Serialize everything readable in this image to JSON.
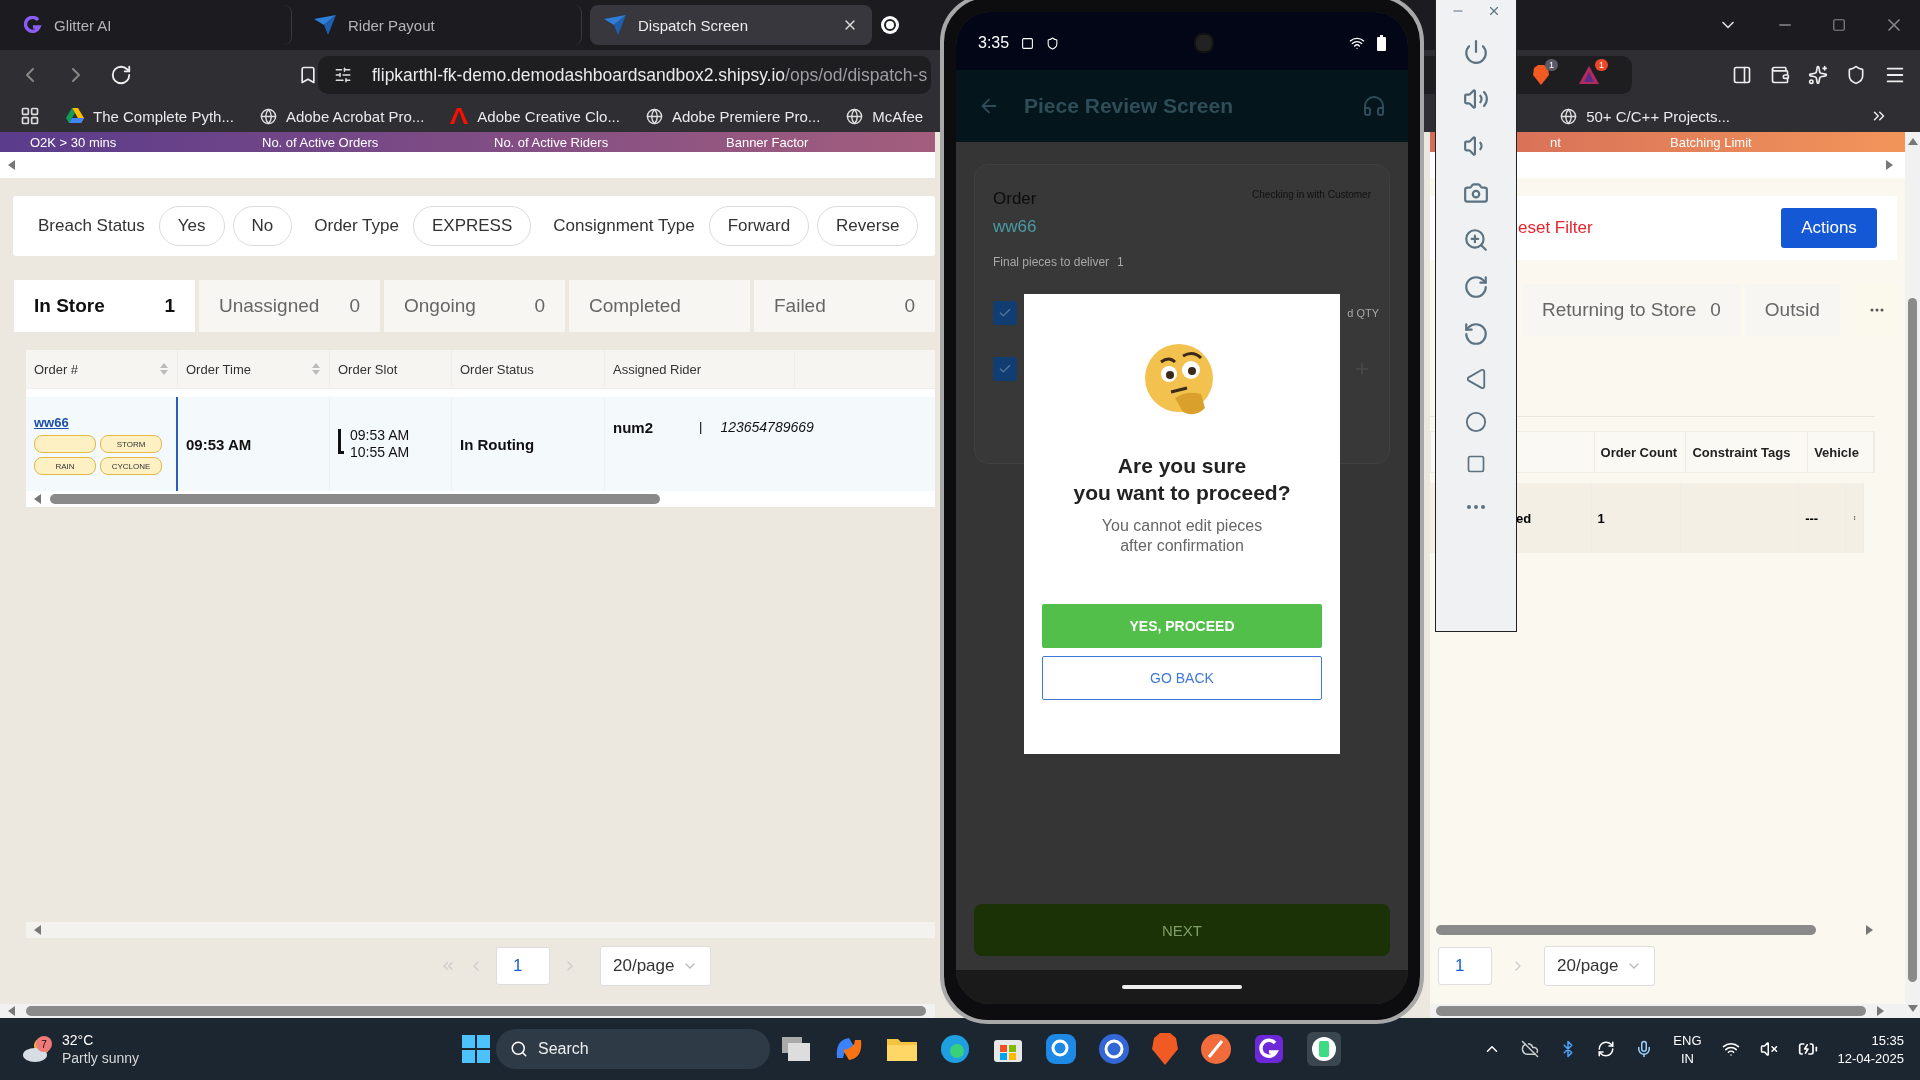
{
  "browser": {
    "tabs": [
      {
        "title": "Glitter AI",
        "selected": false,
        "kind": "glitter"
      },
      {
        "title": "Rider Payout",
        "selected": false,
        "kind": "shipsy"
      },
      {
        "title": "Dispatch Screen",
        "selected": true,
        "kind": "shipsy"
      }
    ],
    "url_host": "flipkarthl-fk-demo.demodashboardsandbox2.shipsy.io",
    "url_path": "/ops/od/dispatch-s",
    "bookmarks": [
      {
        "label": "The Complete Pyth...",
        "kind": "drive"
      },
      {
        "label": "Adobe Acrobat Pro...",
        "kind": "globe"
      },
      {
        "label": "Adobe Creative Clo...",
        "kind": "adobe"
      },
      {
        "label": "Adobe Premiere Pro...",
        "kind": "globe"
      },
      {
        "label": "McAfee",
        "kind": "globe"
      }
    ],
    "extension_badges": [
      "1",
      "1"
    ],
    "bookmarks_right": [
      "50+ C/C++ Projects..."
    ]
  },
  "banner": {
    "left": [
      "O2K > 30 mins",
      "No. of Active Orders",
      "No. of Active Riders",
      "Banner Factor"
    ],
    "right": [
      "nt",
      "Batching Limit"
    ]
  },
  "filters": [
    {
      "label": "Breach Status",
      "options": [
        "Yes",
        "No"
      ]
    },
    {
      "label": "Order Type",
      "options": [
        "EXPRESS"
      ]
    },
    {
      "label": "Consignment Type",
      "options": [
        "Forward",
        "Reverse"
      ]
    }
  ],
  "status_tabs": [
    {
      "label": "In Store",
      "count": "1",
      "selected": true
    },
    {
      "label": "Unassigned",
      "count": "0",
      "selected": false
    },
    {
      "label": "Ongoing",
      "count": "0",
      "selected": false
    },
    {
      "label": "Completed",
      "selected": false
    },
    {
      "label": "Failed",
      "count": "0",
      "selected": false
    }
  ],
  "orders_table": {
    "columns": [
      {
        "label": "Order #",
        "sortable": true
      },
      {
        "label": "Order Time",
        "sortable": true
      },
      {
        "label": "Order Slot",
        "sortable": false
      },
      {
        "label": "Order Status",
        "sortable": false
      },
      {
        "label": "Assigned Rider",
        "sortable": false
      }
    ],
    "rows": [
      {
        "order_id": "ww66",
        "tags": [
          {
            "kind": "blank"
          },
          {
            "kind": "text",
            "label": "STORM"
          },
          {
            "kind": "text",
            "label": "RAIN"
          },
          {
            "kind": "text",
            "label": "CYCLONE"
          }
        ],
        "order_time": "09:53 AM",
        "slot_start": "09:53 AM",
        "slot_end": "10:55 AM",
        "status": "In Routing",
        "rider": "num2",
        "rider_separator": "|",
        "rider_phone": "123654789669"
      }
    ]
  },
  "pagination": {
    "page": "1",
    "page_size": "20/page"
  },
  "right_panel": {
    "reset_filter": "eset Filter",
    "actions": "Actions",
    "tabs": [
      {
        "label": "Returning to Store",
        "count": "0",
        "selected": false
      },
      {
        "label": "Outsid",
        "selected": false
      }
    ],
    "columns": [
      "Order Count",
      "Constraint Tags",
      "Vehicle"
    ],
    "rows": [
      {
        "status_fragment": "ed",
        "order_count": "1",
        "vehicle": "---"
      }
    ],
    "pagination": {
      "page": "1",
      "page_size": "20/page"
    }
  },
  "phone": {
    "time": "3:35",
    "title": "Piece Review Screen",
    "order_label": "Order",
    "order_id": "ww66",
    "order_state": "Checking in with Customer",
    "pieces_label": "Final pieces to deliver",
    "pieces_count": "1",
    "pieces": [
      {
        "checked": true,
        "qty_label": "d QTY"
      },
      {
        "checked": true
      }
    ],
    "next": "NEXT",
    "dialog": {
      "title": [
        "Are you sure",
        "you want to proceed?"
      ],
      "message": [
        "You cannot edit pieces",
        "after confirmation"
      ],
      "confirm": "YES, PROCEED",
      "cancel": "GO BACK"
    }
  },
  "taskbar": {
    "temperature": "32°C",
    "weather": "Partly sunny",
    "weather_badge": "7",
    "search_label": "Search",
    "language": "ENG",
    "region": "IN",
    "time": "15:35",
    "date": "12-04-2025"
  }
}
